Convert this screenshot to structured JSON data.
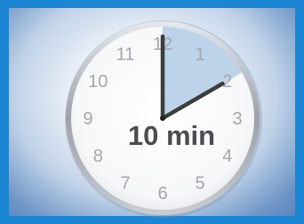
{
  "clock": {
    "numbers": [
      "12",
      "1",
      "2",
      "3",
      "4",
      "5",
      "6",
      "7",
      "8",
      "9",
      "10",
      "11"
    ],
    "label": "10 min",
    "elapsed_minutes": 10,
    "time_hour": 2,
    "time_minute": 0
  },
  "colors": {
    "frame": "#1b86d3",
    "elapsed_sector": "#bcd3ea",
    "hands": "#3d3d3d",
    "numbers": "#a3a6ab",
    "label": "#4a4c50"
  }
}
